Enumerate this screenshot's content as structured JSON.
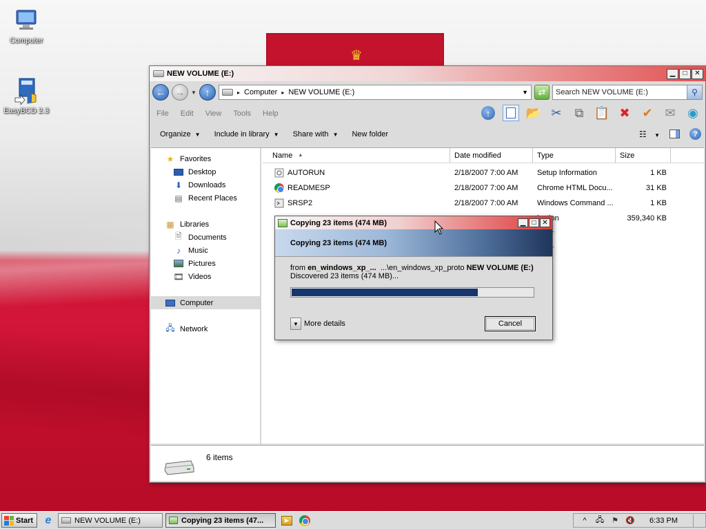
{
  "desktop": {
    "icons": [
      {
        "label": "Computer",
        "icon": "computer-icon"
      },
      {
        "label": "EasyBCD 2.3",
        "icon": "easybcd-icon"
      }
    ]
  },
  "explorer": {
    "title": "NEW VOLUME (E:)",
    "breadcrumb": [
      "Computer",
      "NEW VOLUME (E:)"
    ],
    "search_placeholder": "Search NEW VOLUME (E:)",
    "menu": [
      "File",
      "Edit",
      "View",
      "Tools",
      "Help"
    ],
    "commands": [
      "Organize",
      "Include in library",
      "Share with",
      "New folder"
    ],
    "nav": {
      "favorites": "Favorites",
      "favorites_items": [
        "Desktop",
        "Downloads",
        "Recent Places"
      ],
      "libraries": "Libraries",
      "libraries_items": [
        "Documents",
        "Music",
        "Pictures",
        "Videos"
      ],
      "computer": "Computer",
      "network": "Network"
    },
    "columns": [
      "Name",
      "Date modified",
      "Type",
      "Size"
    ],
    "files": [
      {
        "name": "AUTORUN",
        "date": "2/18/2007 7:00 AM",
        "type": "Setup Information",
        "size": "1 KB",
        "icon": "setup-file-icon"
      },
      {
        "name": "READMESP",
        "date": "2/18/2007 7:00 AM",
        "type": "Chrome HTML Docu...",
        "size": "31 KB",
        "icon": "chrome-html-icon"
      },
      {
        "name": "SRSP2",
        "date": "2/18/2007 7:00 AM",
        "type": "Windows Command ...",
        "size": "1 KB",
        "icon": "command-script-icon"
      },
      {
        "name": "",
        "date": "",
        "type": "ication",
        "size": "359,340 KB",
        "icon": "application-icon"
      },
      {
        "name": "",
        "date": "",
        "type": "older",
        "size": "",
        "icon": "folder-icon"
      },
      {
        "name": "",
        "date": "",
        "type": "older",
        "size": "",
        "icon": "folder-icon"
      }
    ],
    "status": "6 items"
  },
  "copy_dialog": {
    "title": "Copying 23 items (474 MB)",
    "heading": "Copying 23 items (474 MB)",
    "from_label": "from",
    "from_source": "en_windows_xp_...",
    "from_path": "...\\en_windows_xp_pro",
    "to_label": "to",
    "to_dest": "NEW VOLUME (E:)",
    "discovered": "Discovered 23 items (474 MB)...",
    "progress_fraction": 0.77,
    "more_details": "More details",
    "cancel": "Cancel"
  },
  "taskbar": {
    "start": "Start",
    "tasks": [
      {
        "label": "NEW VOLUME (E:)",
        "active": false
      },
      {
        "label": "Copying 23 items (47...",
        "active": true
      }
    ],
    "time": "6:33 PM",
    "tray_expand": "^"
  },
  "colors": {
    "title_gradient_end": "#e25252",
    "flag_red": "#c8122d",
    "progress": "#17356f"
  }
}
